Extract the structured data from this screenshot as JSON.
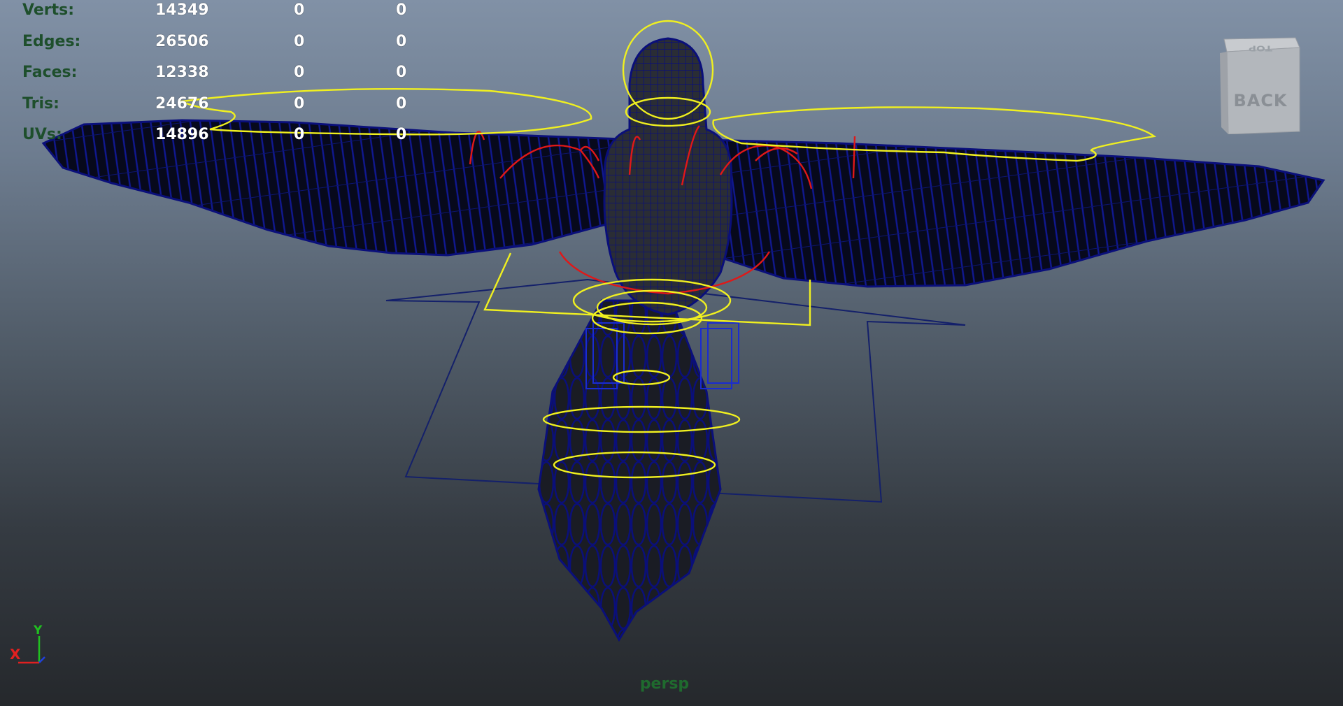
{
  "hud": {
    "rows": [
      {
        "label": "Verts:",
        "values": [
          "14349",
          "0",
          "0"
        ]
      },
      {
        "label": "Edges:",
        "values": [
          "26506",
          "0",
          "0"
        ]
      },
      {
        "label": "Faces:",
        "values": [
          "12338",
          "0",
          "0"
        ]
      },
      {
        "label": "Tris:",
        "values": [
          "24676",
          "0",
          "0"
        ]
      },
      {
        "label": "UVs:",
        "values": [
          "14896",
          "0",
          "0"
        ]
      }
    ]
  },
  "viewcube": {
    "front_label": "BACK",
    "top_label": "TOP"
  },
  "camera": {
    "name": "persp"
  },
  "axis": {
    "x_label": "X",
    "y_label": "Y"
  },
  "colors": {
    "wireframe": "#0a0f7a",
    "control_curves": "#f0f020",
    "joints": "#e01818",
    "hud_label": "#1e4f2c",
    "camera_label": "#1f6a2e"
  }
}
